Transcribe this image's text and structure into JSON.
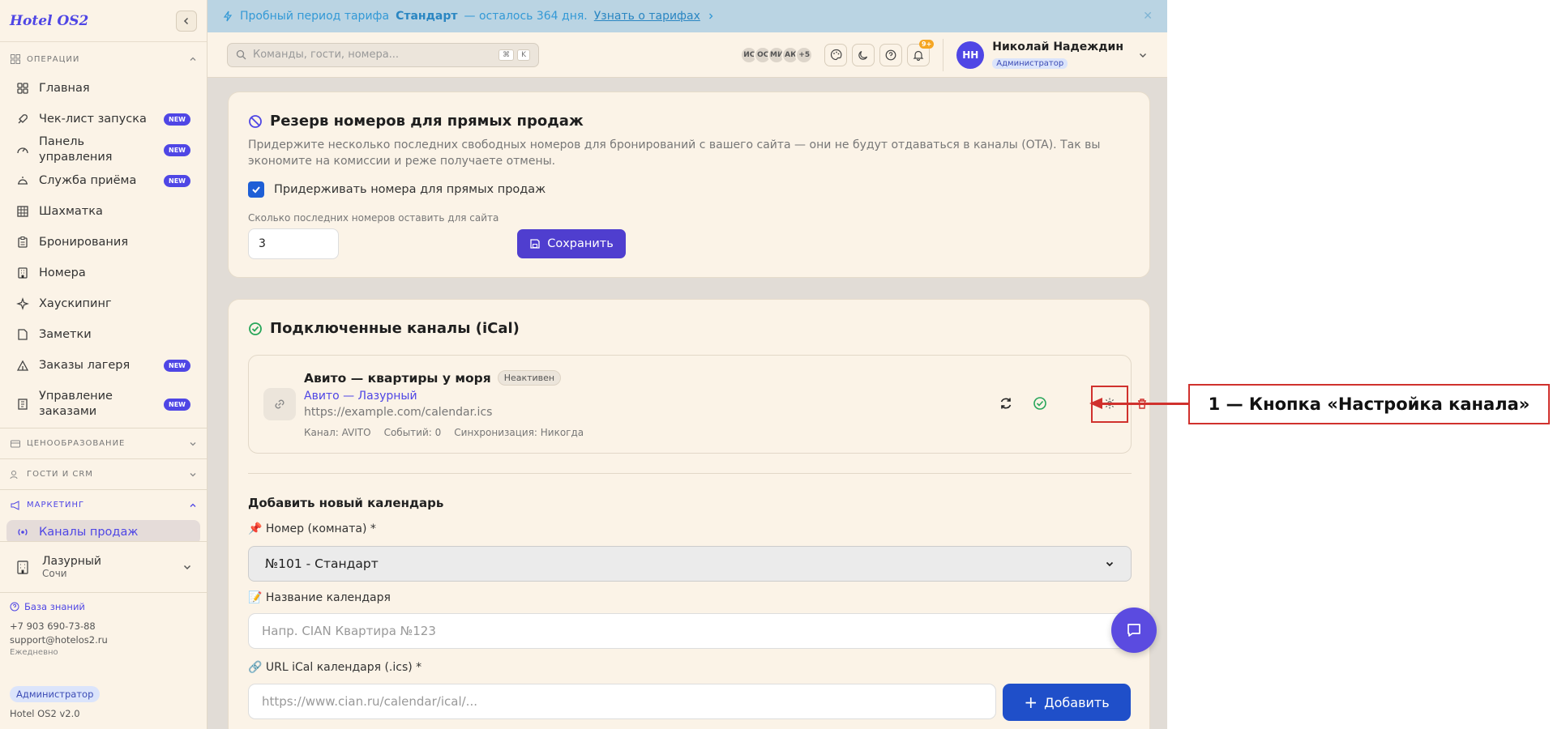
{
  "app": {
    "logo": "Hotel OS2"
  },
  "sidebar": {
    "sections": {
      "operations": "ОПЕРАЦИИ",
      "pricing": "ЦЕНООБРАЗОВАНИЕ",
      "guests": "ГОСТИ И CRM",
      "marketing": "МАРКЕТИНГ"
    },
    "items": [
      {
        "label": "Главная",
        "badge": "",
        "icon": "grid-icon"
      },
      {
        "label": "Чек-лист запуска",
        "badge": "NEW",
        "icon": "rocket-icon"
      },
      {
        "label": "Панель управления",
        "badge": "NEW",
        "icon": "gauge-icon"
      },
      {
        "label": "Служба приёма",
        "badge": "NEW",
        "icon": "bell-desk-icon"
      },
      {
        "label": "Шахматка",
        "badge": "",
        "icon": "table-icon"
      },
      {
        "label": "Бронирования",
        "badge": "",
        "icon": "clipboard-icon"
      },
      {
        "label": "Номера",
        "badge": "",
        "icon": "building-icon"
      },
      {
        "label": "Хаускипинг",
        "badge": "",
        "icon": "sparkle-icon"
      },
      {
        "label": "Заметки",
        "badge": "",
        "icon": "note-icon"
      },
      {
        "label": "Заказы лагеря",
        "badge": "NEW",
        "icon": "tent-icon"
      },
      {
        "label": "Управление заказами",
        "badge": "NEW",
        "icon": "receipt-icon"
      }
    ],
    "active_item": "Каналы продаж",
    "hotel": {
      "name": "Лазурный",
      "city": "Сочи"
    },
    "footer": {
      "knowledge_base": "База знаний",
      "phone": "+7 903 690-73-88",
      "email": "support@hotelos2.ru",
      "schedule": "Ежедневно",
      "role": "Администратор",
      "version": "Hotel OS2 v2.0"
    }
  },
  "banner": {
    "text_prefix": "Пробный период тарифа",
    "plan": "Стандарт",
    "text_suffix": "— осталось 364 дня.",
    "link": "Узнать о тарифах"
  },
  "topbar": {
    "search_placeholder": "Команды, гости, номера...",
    "shortcut_keys": [
      "⌘",
      "K"
    ],
    "avatars": [
      "ИС",
      "ОС",
      "МИ",
      "АК"
    ],
    "avatars_more": "+5",
    "notifications": "9+",
    "user": {
      "initials": "НН",
      "name": "Николай Надеждин",
      "role": "Администратор"
    }
  },
  "reserve_card": {
    "title": "Резерв номеров для прямых продаж",
    "description": "Придержите несколько последних свободных номеров для бронирований с вашего сайта — они не будут отдаваться в каналы (OTA). Так вы экономите на комиссии и реже получаете отмены.",
    "checkbox_label": "Придерживать номера для прямых продаж",
    "checkbox_checked": true,
    "count_label": "Сколько последних номеров оставить для сайта",
    "count_value": "3",
    "save_label": "Сохранить"
  },
  "channels_card": {
    "title": "Подключенные каналы (iCal)",
    "channel": {
      "name": "Авито — квартиры у моря",
      "status": "Неактивен",
      "hotel_link": "Авито — Лазурный",
      "url": "https://example.com/calendar.ics",
      "channel": "Канал: AVITO",
      "events": "Событий: 0",
      "sync": "Синхронизация: Никогда"
    },
    "add_title": "Добавить новый календарь",
    "room_label": "📌 Номер (комната) *",
    "room_value": "№101 - Стандарт",
    "name_label": "📝 Название календаря",
    "name_placeholder": "Напр. CIAN Квартира №123",
    "url_label": "🔗 URL iCal календаря (.ics) *",
    "url_placeholder": "https://www.cian.ru/calendar/ical/...",
    "add_label": "Добавить"
  },
  "annotation": {
    "label": "1 — Кнопка «Настройка канала»"
  },
  "colors": {
    "accent": "#4f46e5",
    "highlight": "#d0312d",
    "banner": "#bad4e3"
  }
}
